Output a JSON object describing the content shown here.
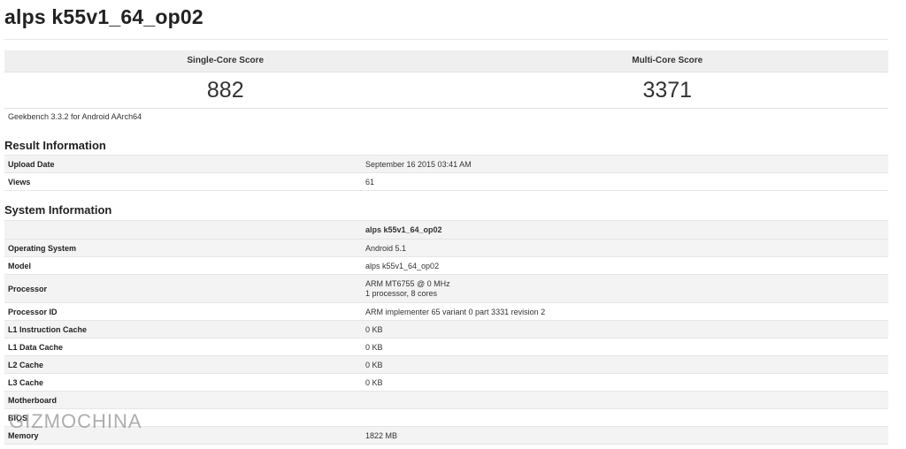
{
  "page": {
    "title": "alps k55v1_64_op02"
  },
  "scores": {
    "single_label": "Single-Core Score",
    "multi_label": "Multi-Core Score",
    "single_value": "882",
    "multi_value": "3371"
  },
  "version": "Geekbench 3.3.2 for Android AArch64",
  "result_info": {
    "title": "Result Information",
    "rows": [
      {
        "label": "Upload Date",
        "value": "September 16 2015 03:41 AM"
      },
      {
        "label": "Views",
        "value": "61"
      }
    ]
  },
  "system_info": {
    "title": "System Information",
    "device_header": "alps k55v1_64_op02",
    "rows": [
      {
        "label": "Operating System",
        "value": "Android 5.1"
      },
      {
        "label": "Model",
        "value": "alps k55v1_64_op02"
      },
      {
        "label": "Processor",
        "value": "ARM MT6755 @ 0 MHz",
        "value2": "1 processor, 8 cores"
      },
      {
        "label": "Processor ID",
        "value": "ARM implementer 65 variant 0 part 3331 revision 2"
      },
      {
        "label": "L1 Instruction Cache",
        "value": "0 KB"
      },
      {
        "label": "L1 Data Cache",
        "value": "0 KB"
      },
      {
        "label": "L2 Cache",
        "value": "0 KB"
      },
      {
        "label": "L3 Cache",
        "value": "0 KB"
      },
      {
        "label": "Motherboard",
        "value": ""
      },
      {
        "label": "BIOS",
        "value": ""
      },
      {
        "label": "Memory",
        "value": "1822 MB"
      }
    ]
  },
  "watermark": "GIZMOCHINA"
}
